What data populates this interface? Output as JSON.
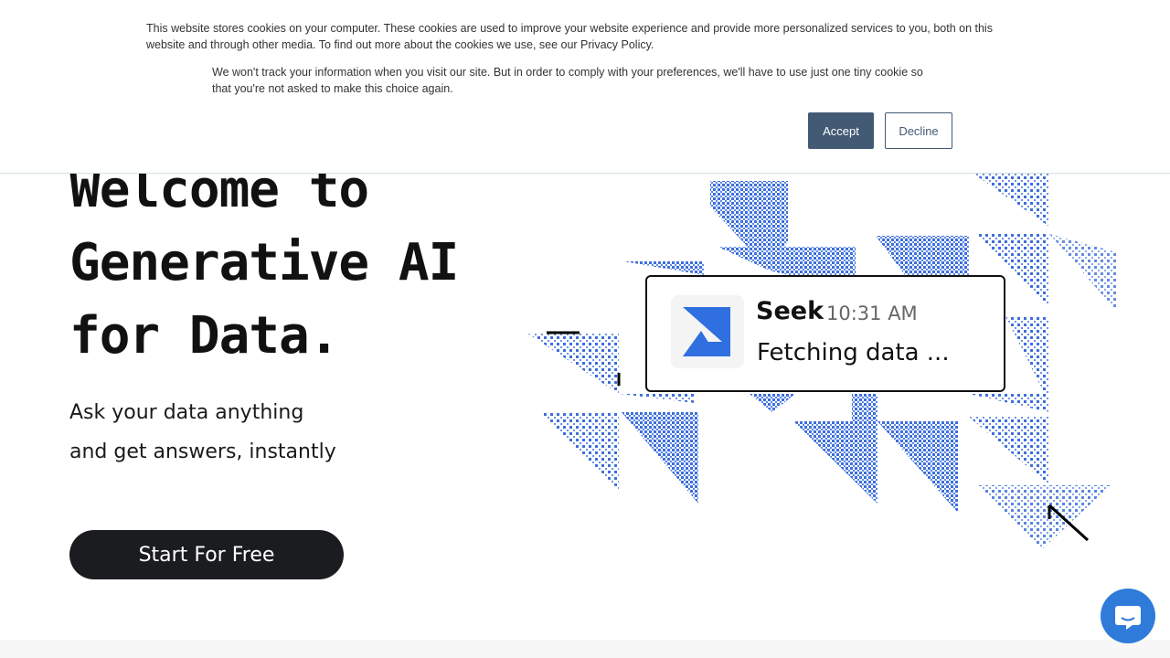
{
  "cookie_banner": {
    "text_primary": "This website stores cookies on your computer. These cookies are used to improve your website experience and provide more personalized services to you, both on this website and through other media. To find out more about the cookies we use, see our Privacy Policy.",
    "text_secondary": "We won't track your information when you visit our site. But in order to comply with your preferences, we'll have to use just one tiny cookie so that you're not asked to make this choice again.",
    "accept_label": "Accept",
    "decline_label": "Decline"
  },
  "hero": {
    "title_lines": [
      "Welcome to",
      "Generative AI",
      "for Data."
    ],
    "subtitle_lines": [
      "Ask your data anything",
      "and get answers, instantly"
    ],
    "cta_label": "Start For Free"
  },
  "chat_card": {
    "sender": "Seek",
    "time": "10:31 AM",
    "message": "Fetching data ..."
  },
  "colors": {
    "accent_blue": "#3d6fdc",
    "accept_bg": "#435a75",
    "cta_bg": "#1b1c1f",
    "chat_widget": "#2f7bd9"
  },
  "icons": {
    "card_logo": "seek-logo-icon",
    "chat_widget": "chat-bubble-icon"
  }
}
